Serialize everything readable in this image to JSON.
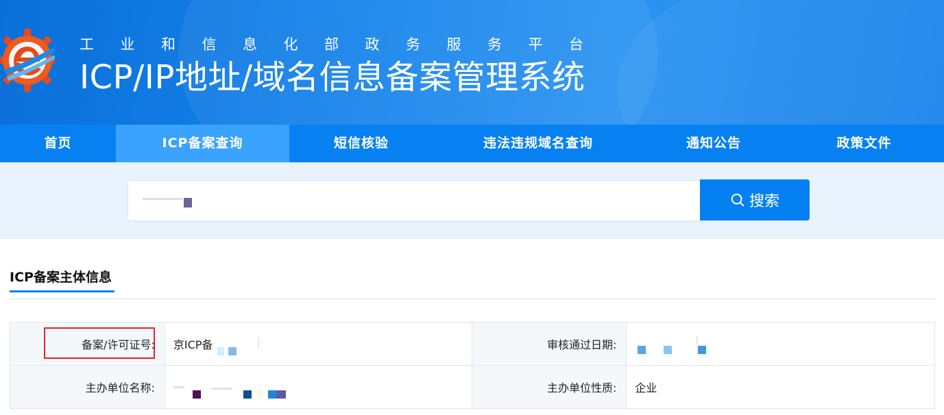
{
  "header": {
    "subtitle": "工业和信息化部政务服务平台",
    "title": "ICP/IP地址/域名信息备案管理系统",
    "logo_icon": "gear-e-logo-icon"
  },
  "nav": {
    "items": [
      {
        "label": "首页",
        "active": false
      },
      {
        "label": "ICP备案查询",
        "active": true
      },
      {
        "label": "短信核验",
        "active": false
      },
      {
        "label": "违法违规域名查询",
        "active": false
      },
      {
        "label": "通知公告",
        "active": false
      },
      {
        "label": "政策文件",
        "active": false
      }
    ]
  },
  "search": {
    "value": "",
    "button_label": "搜索",
    "button_icon": "search-icon"
  },
  "section": {
    "title": "ICP备案主体信息"
  },
  "info": {
    "row1": {
      "label_a": "备案/许可证号:",
      "value_a": "京ICP备",
      "label_b": "审核通过日期:",
      "value_b": ""
    },
    "row2": {
      "label_a": "主办单位名称:",
      "value_a": "",
      "label_b": "主办单位性质:",
      "value_b": "企业"
    }
  },
  "colors": {
    "header_blue": "#1582ea",
    "nav_blue": "#0780f2",
    "nav_active": "#3aa2ff",
    "search_band": "#e8f2fc",
    "button_blue": "#0580f2",
    "highlight_red": "#e02727"
  }
}
